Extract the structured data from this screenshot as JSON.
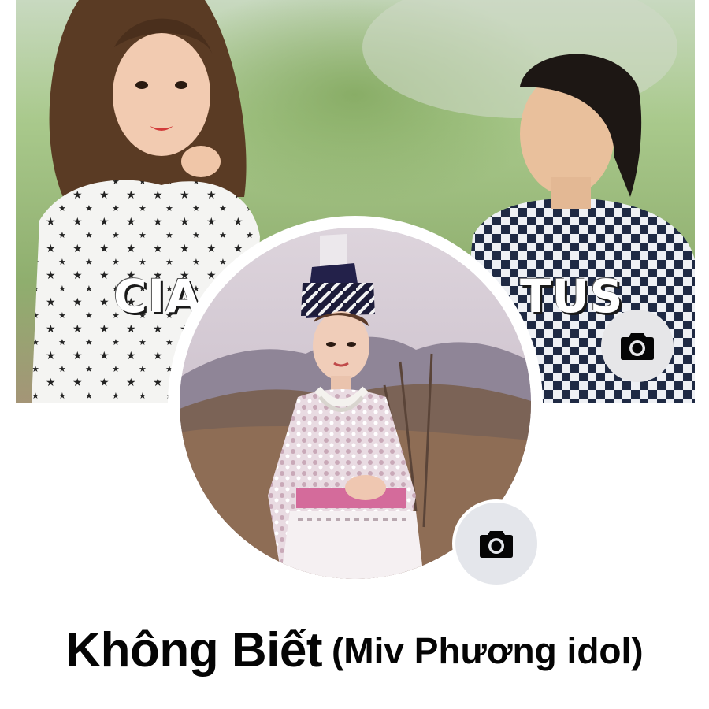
{
  "cover": {
    "overlay_text_left": "CIA L",
    "overlay_text_right": "TUS",
    "camera_icon": "camera-icon"
  },
  "profile": {
    "camera_icon": "camera-icon",
    "name": "Không Biết",
    "alternate_name": "(Miv Phương idol)"
  },
  "colors": {
    "background": "#ffffff",
    "camera_button": "#e4e6eb",
    "name_text": "#050505"
  }
}
